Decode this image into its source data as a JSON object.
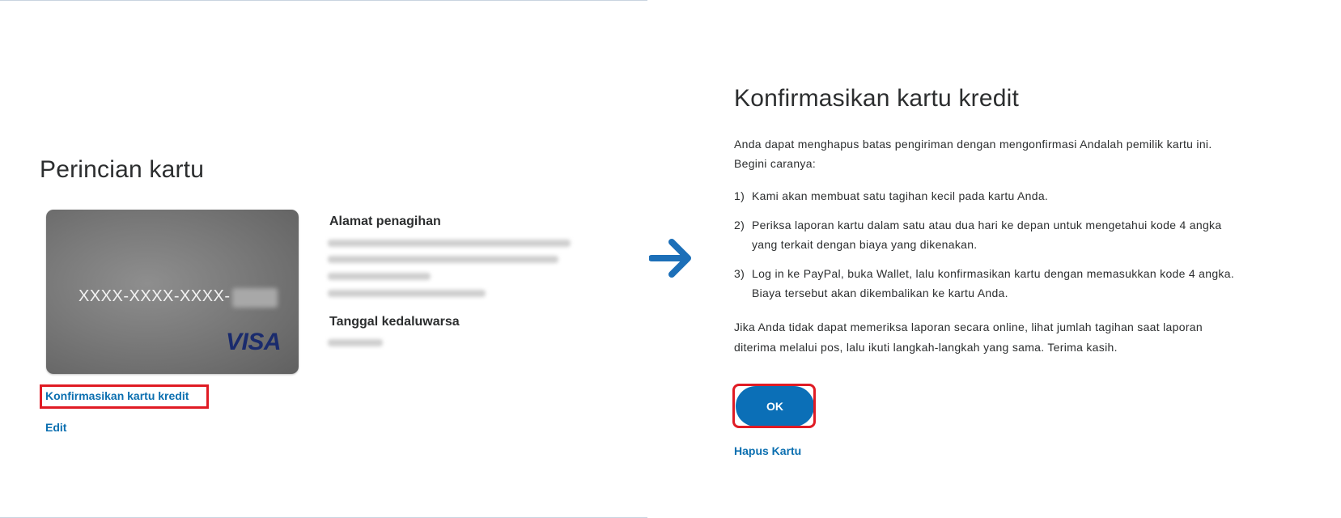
{
  "left": {
    "title": "Perincian kartu",
    "card": {
      "number_masked": "XXXX-XXXX-XXXX-",
      "brand": "VISA"
    },
    "billing_address_label": "Alamat penagihan",
    "expiry_label": "Tanggal kedaluwarsa",
    "confirm_link": "Konfirmasikan kartu kredit",
    "edit_link": "Edit"
  },
  "right": {
    "title": "Konfirmasikan kartu kredit",
    "intro_line1": "Anda dapat menghapus batas pengiriman dengan mengonfirmasi Andalah pemilik kartu ini.",
    "intro_line2": "Begini caranya:",
    "steps": [
      {
        "num": "1)",
        "lines": [
          "Kami akan membuat satu tagihan kecil pada kartu Anda."
        ]
      },
      {
        "num": "2)",
        "lines": [
          "Periksa laporan kartu dalam satu atau dua hari ke depan untuk mengetahui kode 4 angka",
          "yang terkait dengan biaya yang dikenakan."
        ]
      },
      {
        "num": "3)",
        "lines": [
          "Log in ke PayPal, buka Wallet, lalu konfirmasikan kartu dengan memasukkan kode 4 angka.",
          "Biaya tersebut akan dikembalikan ke kartu Anda."
        ]
      }
    ],
    "note_line1": "Jika Anda tidak dapat memeriksa laporan secara online, lihat jumlah tagihan saat laporan",
    "note_line2": "diterima melalui pos, lalu ikuti langkah-langkah yang sama. Terima kasih.",
    "ok_button": "OK",
    "remove_link": "Hapus Kartu"
  },
  "colors": {
    "link": "#0b6fb0",
    "button": "#0b6fb7",
    "highlight": "#e01b24",
    "arrow": "#1c6fb8"
  },
  "icons": {
    "arrow": "arrow-right-icon"
  }
}
